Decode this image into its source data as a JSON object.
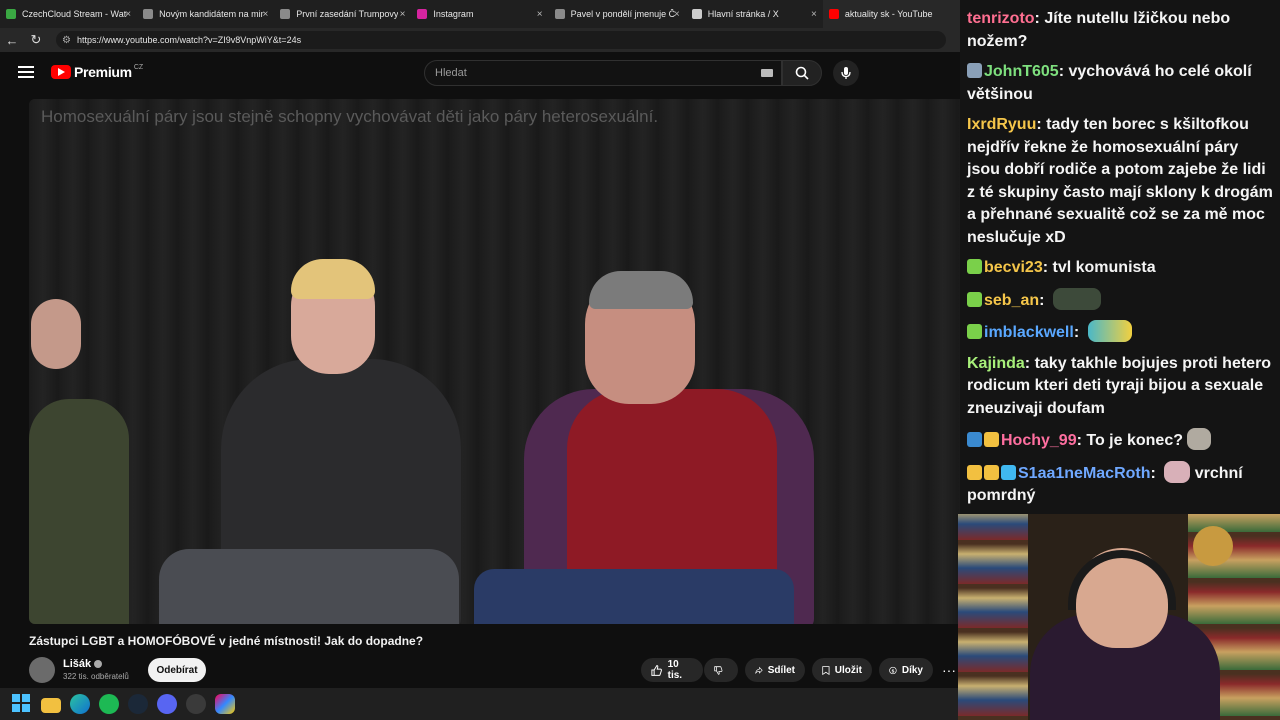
{
  "browser": {
    "tabs": [
      {
        "title": "CzechCloud Stream - Watch",
        "favicon_color": "#3aa843"
      },
      {
        "title": "Novým kandidátem na minis",
        "favicon_color": "#8a8a8a"
      },
      {
        "title": "První zasedání Trumpovy",
        "favicon_color": "#8a8a8a"
      },
      {
        "title": "Instagram",
        "favicon_color": "#d6249f"
      },
      {
        "title": "Pavel v pondělí jmenuje Č",
        "favicon_color": "#8a8a8a"
      },
      {
        "title": "Hlavní stránka / X",
        "favicon_color": "#cccccc"
      },
      {
        "title": "aktuality sk - YouTube",
        "favicon_color": "#ff0000"
      }
    ],
    "url": "https://www.youtube.com/watch?v=ZI9v8VnpWiY&t=24s"
  },
  "youtube": {
    "brand": "Premium",
    "country_code": "CZ",
    "search_placeholder": "Hledat",
    "video_caption": "Homosexuální páry jsou stejně schopny vychovávat děti jako páry heterosexuální.",
    "video_title": "Zástupci LGBT a HOMOFÓBOVÉ v jedné místnosti! Jak do dopadne?",
    "channel_name": "Lišák",
    "subscribers": "322 tis. odběratelů",
    "subscribe_label": "Odebírat",
    "likes": "10 tis.",
    "share_label": "Sdílet",
    "save_label": "Uložit",
    "thanks_label": "Díky",
    "more_label": "···"
  },
  "chat": {
    "messages": [
      {
        "user": "tenrizoto",
        "color": "#ff6f91",
        "text": "Jíte nutellu lžičkou nebo nožem?"
      },
      {
        "user": "JohnT605",
        "color": "#7ee07e",
        "text": "vychovává ho celé okolí většinou"
      },
      {
        "user": "IxrdRyuu",
        "color": "#f5c64a",
        "text": "tady ten borec s kšiltofkou nejdřív řekne že homosexuální páry jsou dobří rodiče a potom zajebe že lidi z té skupiny často mají sklony k drogám a přehnané sexualitě což se za mě moc neslučuje xD"
      },
      {
        "user": "becvi23",
        "color": "#f5c64a",
        "text": "tvl komunista"
      },
      {
        "user": "seb_an",
        "color": "#f5c64a",
        "text": ""
      },
      {
        "user": "imblackwell",
        "color": "#5aa8ff",
        "text": ""
      },
      {
        "user": "Kajinda",
        "color": "#a8f07a",
        "text": "taky takhle bojujes proti hetero rodicum kteri deti tyraji bijou a sexuale zneuzivaji doufam"
      },
      {
        "user": "Hochy_99",
        "color": "#ff6fa0",
        "text": "To je konec?"
      },
      {
        "user": "S1aa1neMacRoth",
        "color": "#6fa8ff",
        "text": "vrchní pomrdný"
      }
    ]
  }
}
